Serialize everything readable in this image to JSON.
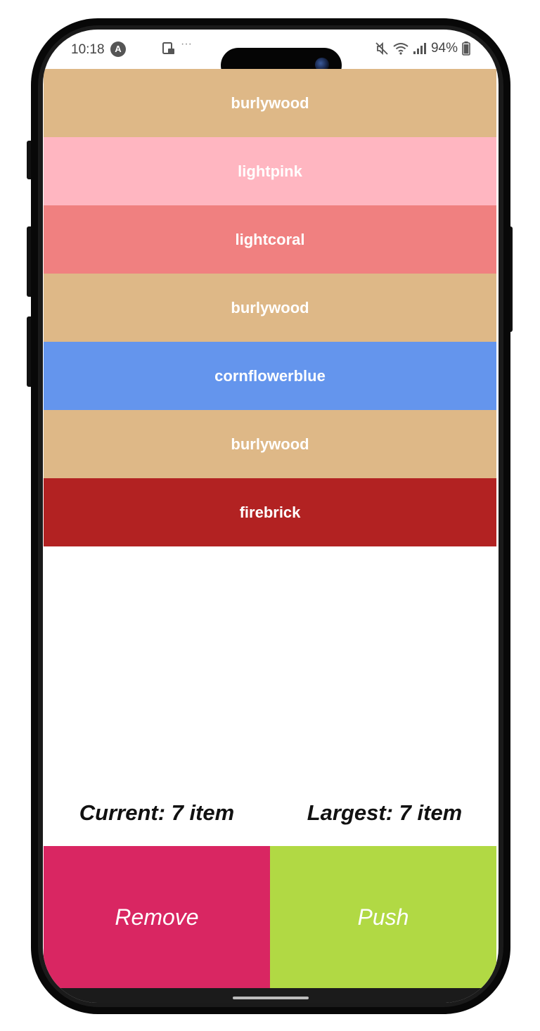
{
  "status_bar": {
    "time": "10:18",
    "app_badge": "A",
    "overflow": "···",
    "battery": "94%"
  },
  "list": {
    "items": [
      {
        "label": "burlywood",
        "color": "#DEB887"
      },
      {
        "label": "lightpink",
        "color": "#FFB6C1"
      },
      {
        "label": "lightcoral",
        "color": "#F08080"
      },
      {
        "label": "burlywood",
        "color": "#DEB887"
      },
      {
        "label": "cornflowerblue",
        "color": "#6495ED"
      },
      {
        "label": "burlywood",
        "color": "#DEB887"
      },
      {
        "label": "firebrick",
        "color": "#B22222"
      }
    ]
  },
  "counters": {
    "current": "Current: 7 item",
    "largest": "Largest: 7 item"
  },
  "actions": {
    "remove_label": "Remove",
    "remove_color": "#D92662",
    "push_label": "Push",
    "push_color": "#B1D944"
  }
}
